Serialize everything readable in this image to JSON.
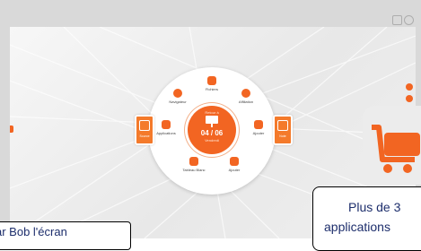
{
  "launcher": {
    "center_title": "Retour à",
    "center_date": "04 / 06",
    "center_day": "Vendredi",
    "items": [
      {
        "label": "Fichiers",
        "icon": "folder-icon"
      },
      {
        "label": "Affiliation",
        "icon": "chat-icon"
      },
      {
        "label": "Ajouter",
        "icon": "plus-icon"
      },
      {
        "label": "Ajouter",
        "icon": "plus-icon"
      },
      {
        "label": "Tableau Blanc",
        "icon": "whiteboard-icon"
      },
      {
        "label": "Applications",
        "icon": "grid-icon"
      },
      {
        "label": "Navigateur",
        "icon": "globe-icon"
      }
    ],
    "side_left_label": "Source",
    "side_right_label": "Note"
  },
  "callouts": {
    "left_text": "ar Bob l'écran",
    "right_line1": "Plus de 3",
    "right_line2": "applications"
  },
  "colors": {
    "accent": "#f26522",
    "callout_text": "#1d2e6c"
  }
}
